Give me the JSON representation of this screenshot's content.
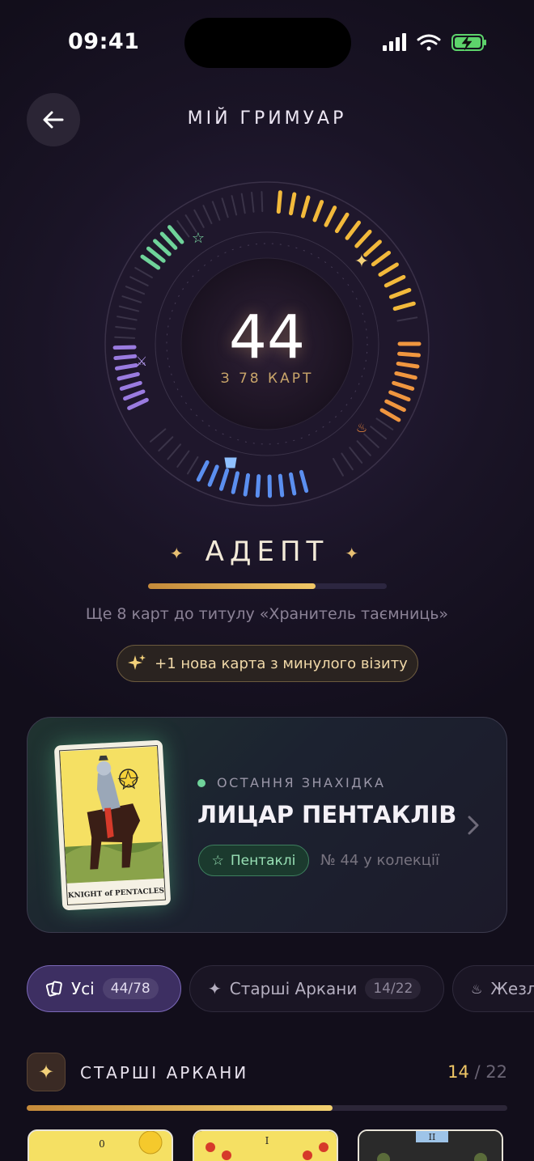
{
  "status_bar": {
    "time": "09:41"
  },
  "header": {
    "title": "МІЙ ГРИМУАР"
  },
  "collection": {
    "count": "44",
    "total_label": "З 78 КАРТ",
    "owned": 44,
    "total": 78
  },
  "rank": {
    "title": "АДЕПТ",
    "progress": 0.7,
    "hint": "Ще 8 карт до титулу «Хранитель таємниць»"
  },
  "new_since_visit": "+1 нова карта з минулого візиту",
  "last_find": {
    "kicker": "ОСТАННЯ ЗНАХІДКА",
    "name": "ЛИЦАР ПЕНТАКЛІВ",
    "suit": "Пентаклі",
    "number": "№ 44 у колекції",
    "card_caption": "KNIGHT of PENTACLES"
  },
  "filters": [
    {
      "label": "Усі",
      "badge": "44/78",
      "icon": "cards-icon"
    },
    {
      "label": "Старші Аркани",
      "badge": "14/22",
      "icon": "sparkle-icon"
    },
    {
      "label": "Жезли",
      "badge": "",
      "icon": "flame-icon"
    }
  ],
  "section": {
    "title": "СТАРШІ АРКАНИ",
    "owned": "14",
    "total": "22",
    "progress": 0.636
  },
  "thumbnails": [
    "0",
    "I",
    "II"
  ],
  "colors": {
    "accent_gold": "#f0c766",
    "green": "#6fd39a",
    "violet": "#9a7be0",
    "blue": "#5b8ff0",
    "orange": "#f0963f",
    "yellow": "#f2b93b"
  }
}
